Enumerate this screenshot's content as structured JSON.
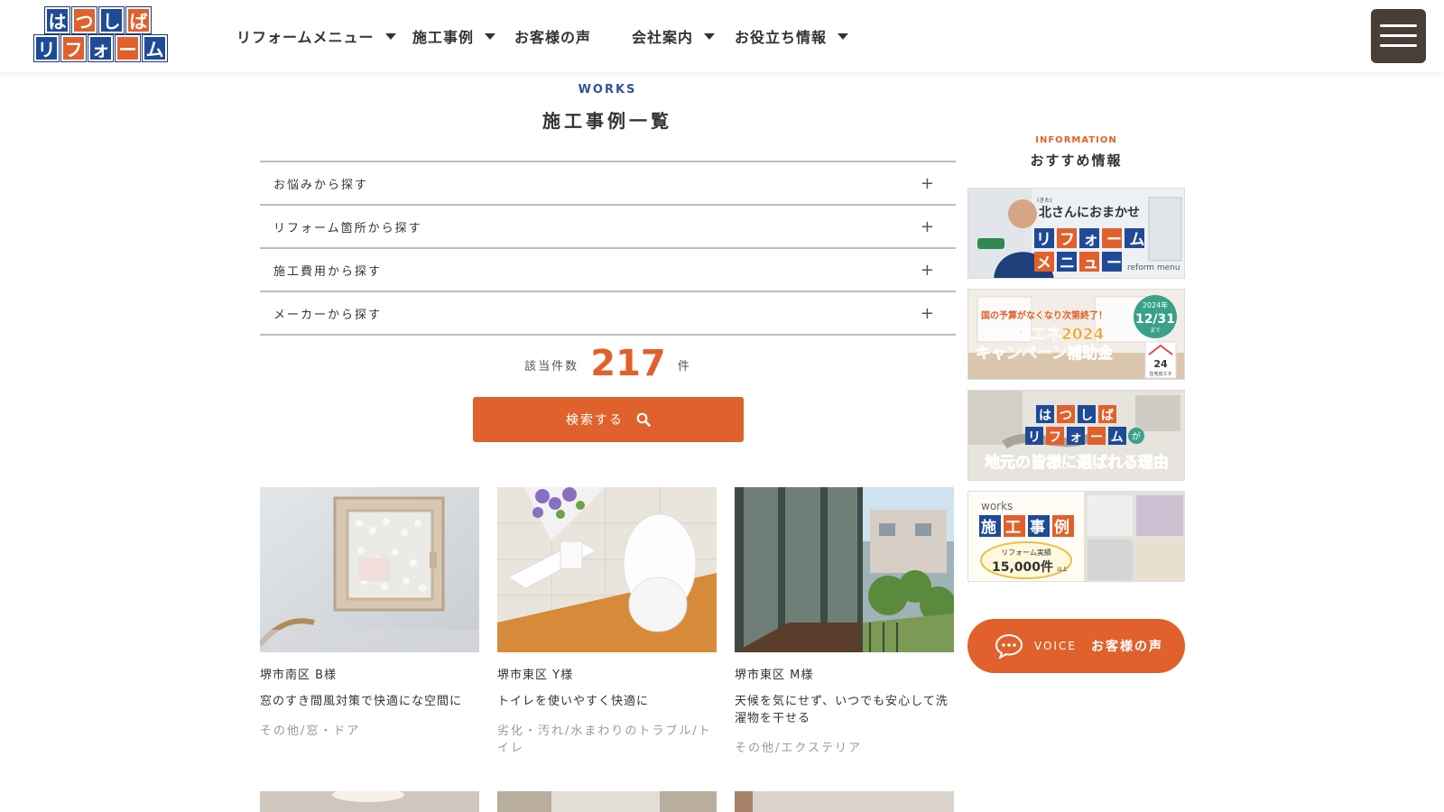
{
  "header": {
    "logo": {
      "row1": [
        "は",
        "つ",
        "し",
        "ば"
      ],
      "row2": [
        "リ",
        "フ",
        "ォ",
        "ー",
        "ム"
      ]
    },
    "nav": [
      {
        "label": "リフォームメニュー",
        "has_caret": true
      },
      {
        "label": "施工事例",
        "has_caret": true
      },
      {
        "label": "お客様の声",
        "has_caret": false
      },
      {
        "label": "会社案内",
        "has_caret": true
      },
      {
        "label": "お役立ち情報",
        "has_caret": true
      }
    ],
    "menu_icon": "hamburger-icon"
  },
  "main": {
    "section_label": "WORKS",
    "title": "施工事例一覧",
    "filters": [
      {
        "label": "お悩みから探す",
        "icon": "+"
      },
      {
        "label": "リフォーム箇所から探す",
        "icon": "+"
      },
      {
        "label": "施工費用から探す",
        "icon": "+"
      },
      {
        "label": "メーカーから探す",
        "icon": "+"
      }
    ],
    "count": {
      "prefix": "該当件数",
      "value": "217",
      "unit": "件"
    },
    "search_button": {
      "label": "検索する",
      "icon": "search-icon"
    },
    "cards": [
      {
        "location": "堺市南区 B様",
        "title": "窓のすき間風対策で快適にな空間に",
        "tags": "その他/窓・ドア"
      },
      {
        "location": "堺市東区 Y様",
        "title": "トイレを使いやすく快適に",
        "tags": "劣化・汚れ/水まわりのトラブル/トイレ"
      },
      {
        "location": "堺市東区 M様",
        "title": "天候を気にせず、いつでも安心して洗濯物を干せる",
        "tags": "その他/エクステリア"
      }
    ]
  },
  "sidebar": {
    "label": "INFORMATION",
    "title": "おすすめ情報",
    "banners": [
      {
        "line1": "北さんにおまかせ",
        "small": "(きた)",
        "line2": "リフォーム",
        "line3": "メニュー",
        "sub": "reform menu"
      },
      {
        "line1": "国の予算がなくなり次第終了！",
        "line2": "住宅省エネ2024",
        "line3": "キャンペーン補助金",
        "badge_year": "2024年",
        "badge_date": "12/31",
        "badge_until": "まで",
        "logo_text": "24",
        "logo_caption": "住宅省エネ"
      },
      {
        "line1": "はつしば",
        "line2": "リフォーム",
        "suffix": "が",
        "line3": "地元の皆様に選ばれる理由"
      },
      {
        "line1": "works",
        "line2": "施工事例",
        "line3": "リフォーム実績",
        "line4": "15,000件",
        "line4_suffix": "以上"
      }
    ],
    "voice": {
      "en": "VOICE",
      "jp": "お客様の声",
      "icon": "speech-bubble-icon"
    }
  },
  "colors": {
    "brand_orange": "#e0612b",
    "brand_blue": "#1f4a96",
    "menu_dark": "#4a3f36"
  }
}
